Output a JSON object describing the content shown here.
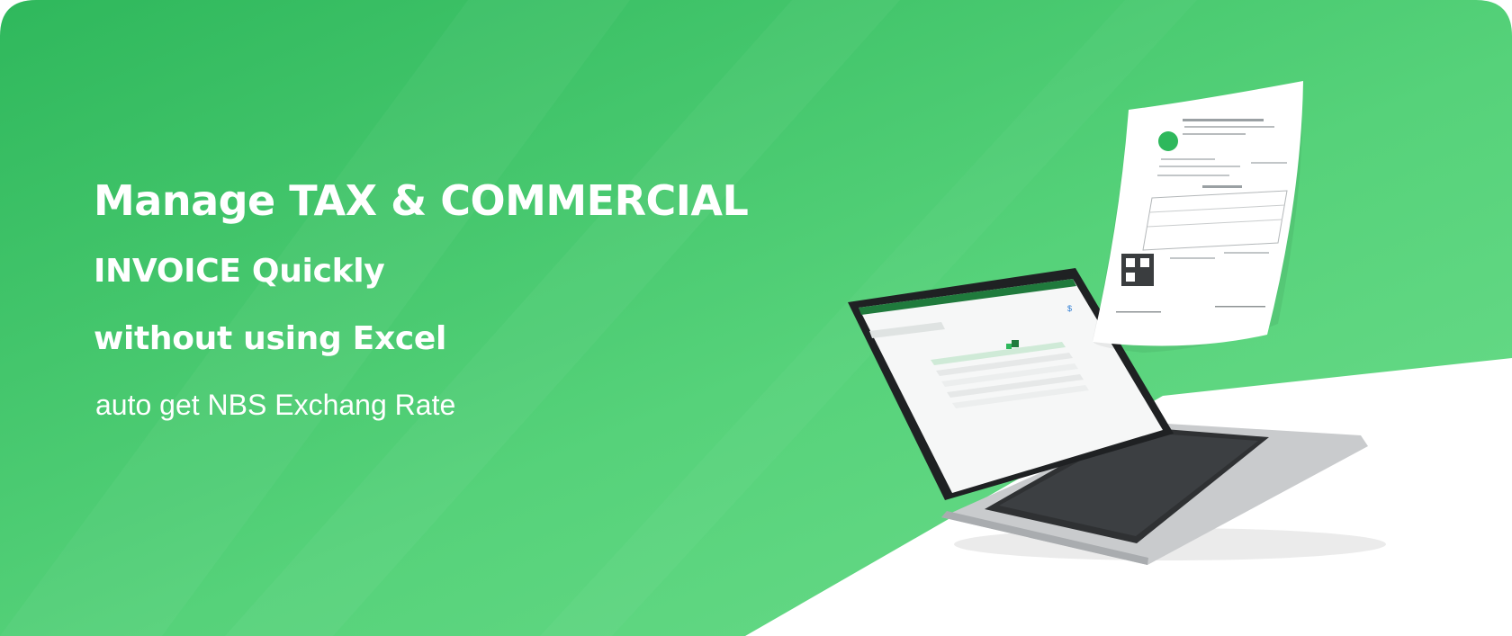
{
  "hero": {
    "title_line1": "Manage TAX & COMMERCIAL",
    "title_line2": "INVOICE Quickly",
    "title_line3": "without using Excel",
    "subtitle": "auto get NBS Exchang Rate"
  },
  "colors": {
    "green_dark": "#2eb85c",
    "green_light": "#67d986",
    "white": "#ffffff"
  },
  "illustration": {
    "laptop_icon": "laptop-icon",
    "invoice_icon": "invoice-document-icon"
  }
}
